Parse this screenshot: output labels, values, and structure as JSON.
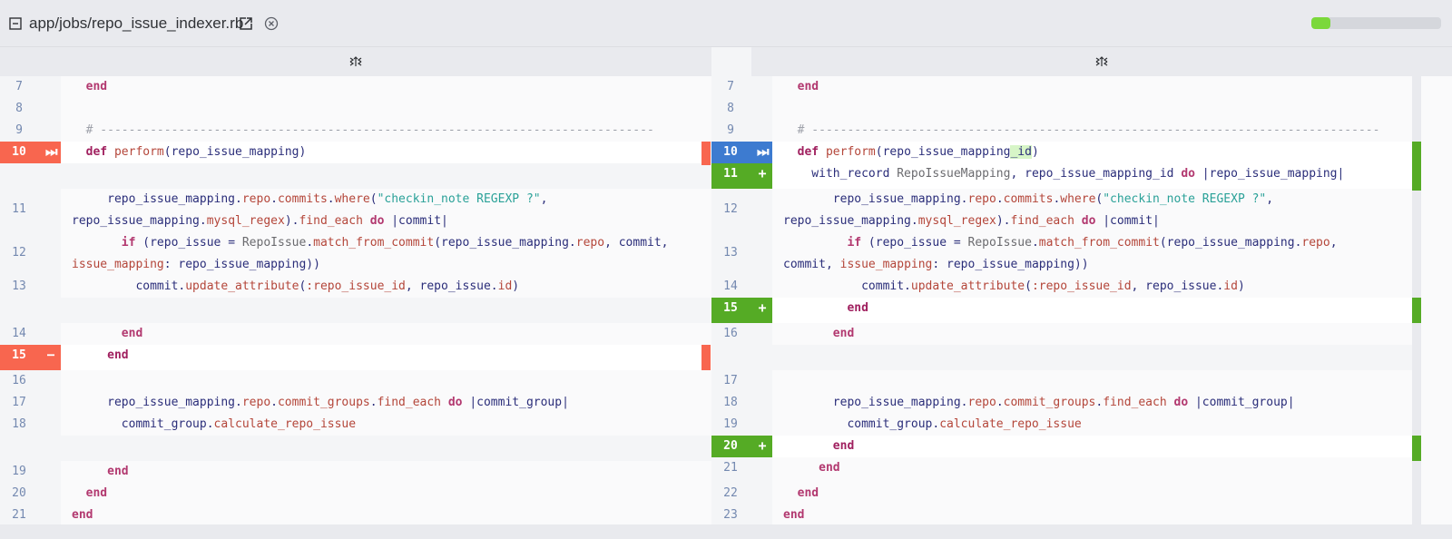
{
  "header": {
    "file_path": "app/jobs/repo_issue_indexer.rb",
    "progress_percent": 15,
    "colors": {
      "progress": "#7bd83b",
      "removed": "#f8664f",
      "changed": "#3d7bd0",
      "added": "#55ab25"
    }
  },
  "icons": {
    "collapse": "collapse-minus-icon",
    "external": "external-link-icon",
    "close": "close-circle-icon",
    "expand": "expand-context-icon"
  },
  "left": {
    "rows": [
      {
        "ln": "7",
        "type": "ctx",
        "tokens": [
          [
            "kw2",
            "  end"
          ]
        ]
      },
      {
        "ln": "8",
        "type": "ctx",
        "tokens": []
      },
      {
        "ln": "9",
        "type": "ctx",
        "tokens": [
          [
            "cmt",
            "  # ------------------------------------------------------------------------------"
          ]
        ]
      },
      {
        "ln": "10",
        "type": "changed-left",
        "marker": "⏭",
        "tokens": [
          [
            "kw",
            "  def "
          ],
          [
            "mth",
            "perform"
          ],
          [
            "punc",
            "(repo_issue_mapping)"
          ]
        ]
      },
      {
        "ln": "",
        "type": "gap",
        "tokens": []
      },
      {
        "ln": "11",
        "type": "ctx2",
        "tokens": [
          [
            "plain",
            "     repo_issue_mapping."
          ],
          [
            "mth",
            "repo"
          ],
          [
            "plain",
            "."
          ],
          [
            "mth",
            "commits"
          ],
          [
            "plain",
            "."
          ],
          [
            "mth",
            "where"
          ],
          [
            "plain",
            "("
          ],
          [
            "str",
            "\"checkin_note REGEXP ?\""
          ],
          [
            "plain",
            ","
          ]
        ],
        "tokens2": [
          [
            "plain",
            "repo_issue_mapping."
          ],
          [
            "mth",
            "mysql_regex"
          ],
          [
            "plain",
            ")."
          ],
          [
            "mth",
            "find_each"
          ],
          [
            "plain",
            " "
          ],
          [
            "kw2",
            "do"
          ],
          [
            "plain",
            " |commit|"
          ]
        ]
      },
      {
        "ln": "12",
        "type": "ctx2",
        "tokens": [
          [
            "plain",
            "       "
          ],
          [
            "kw2",
            "if"
          ],
          [
            "plain",
            " (repo_issue = "
          ],
          [
            "const",
            "RepoIssue"
          ],
          [
            "plain",
            "."
          ],
          [
            "mth",
            "match_from_commit"
          ],
          [
            "plain",
            "(repo_issue_mapping."
          ],
          [
            "mth",
            "repo"
          ],
          [
            "plain",
            ", commit,"
          ]
        ],
        "tokens2": [
          [
            "mth",
            "issue_mapping"
          ],
          [
            "plain",
            ": repo_issue_mapping))"
          ]
        ]
      },
      {
        "ln": "13",
        "type": "ctx",
        "tokens": [
          [
            "plain",
            "         commit."
          ],
          [
            "mth",
            "update_attribute"
          ],
          [
            "plain",
            "("
          ],
          [
            "sym",
            ":repo_issue_id"
          ],
          [
            "plain",
            ", repo_issue."
          ],
          [
            "mth",
            "id"
          ],
          [
            "plain",
            ")"
          ]
        ]
      },
      {
        "ln": "",
        "type": "gap",
        "tokens": []
      },
      {
        "ln": "14",
        "type": "ctx",
        "tokens": [
          [
            "kw2",
            "       end"
          ]
        ]
      },
      {
        "ln": "15",
        "type": "removed",
        "marker": "−",
        "tokens": [
          [
            "kw",
            "     end"
          ]
        ]
      },
      {
        "ln": "16",
        "type": "ctx",
        "tokens": []
      },
      {
        "ln": "17",
        "type": "ctx",
        "tokens": [
          [
            "plain",
            "     repo_issue_mapping."
          ],
          [
            "mth",
            "repo"
          ],
          [
            "plain",
            "."
          ],
          [
            "mth",
            "commit_groups"
          ],
          [
            "plain",
            "."
          ],
          [
            "mth",
            "find_each"
          ],
          [
            "plain",
            " "
          ],
          [
            "kw2",
            "do"
          ],
          [
            "plain",
            " |commit_group|"
          ]
        ]
      },
      {
        "ln": "18",
        "type": "ctx",
        "tokens": [
          [
            "plain",
            "       commit_group."
          ],
          [
            "mth",
            "calculate_repo_issue"
          ]
        ]
      },
      {
        "ln": "",
        "type": "gap",
        "tokens": []
      },
      {
        "ln": "19",
        "type": "ctx",
        "tokens": [
          [
            "kw2",
            "     end"
          ]
        ]
      },
      {
        "ln": "20",
        "type": "ctx",
        "tokens": [
          [
            "kw2",
            "  end"
          ]
        ]
      },
      {
        "ln": "21",
        "type": "ctx",
        "tokens": [
          [
            "kw2",
            "end"
          ]
        ]
      }
    ]
  },
  "right": {
    "rows": [
      {
        "ln": "7",
        "type": "ctx",
        "tokens": [
          [
            "kw2",
            "  end"
          ]
        ]
      },
      {
        "ln": "8",
        "type": "ctx",
        "tokens": []
      },
      {
        "ln": "9",
        "type": "ctx",
        "tokens": [
          [
            "cmt",
            "  # --------------------------------------------------------------------------------"
          ]
        ]
      },
      {
        "ln": "10",
        "type": "changed",
        "marker": "⏭",
        "tokens": [
          [
            "kw",
            "  def "
          ],
          [
            "mth",
            "perform"
          ],
          [
            "punc",
            "(repo_issue_mapping"
          ],
          [
            "hl",
            "_id"
          ],
          [
            "punc",
            ")"
          ]
        ]
      },
      {
        "ln": "11",
        "type": "added",
        "marker": "+",
        "tokens": [
          [
            "plain",
            "    with_record "
          ],
          [
            "const",
            "RepoIssueMapping"
          ],
          [
            "plain",
            ", repo_issue_mapping_id "
          ],
          [
            "kw2",
            "do"
          ],
          [
            "plain",
            " |repo_issue_mapping|"
          ]
        ]
      },
      {
        "ln": "12",
        "type": "ctx2",
        "tokens": [
          [
            "plain",
            "       repo_issue_mapping."
          ],
          [
            "mth",
            "repo"
          ],
          [
            "plain",
            "."
          ],
          [
            "mth",
            "commits"
          ],
          [
            "plain",
            "."
          ],
          [
            "mth",
            "where"
          ],
          [
            "plain",
            "("
          ],
          [
            "str",
            "\"checkin_note REGEXP ?\""
          ],
          [
            "plain",
            ","
          ]
        ],
        "tokens2": [
          [
            "plain",
            "repo_issue_mapping."
          ],
          [
            "mth",
            "mysql_regex"
          ],
          [
            "plain",
            ")."
          ],
          [
            "mth",
            "find_each"
          ],
          [
            "plain",
            " "
          ],
          [
            "kw2",
            "do"
          ],
          [
            "plain",
            " |commit|"
          ]
        ]
      },
      {
        "ln": "13",
        "type": "ctx2",
        "tokens": [
          [
            "plain",
            "         "
          ],
          [
            "kw2",
            "if"
          ],
          [
            "plain",
            " (repo_issue = "
          ],
          [
            "const",
            "RepoIssue"
          ],
          [
            "plain",
            "."
          ],
          [
            "mth",
            "match_from_commit"
          ],
          [
            "plain",
            "(repo_issue_mapping."
          ],
          [
            "mth",
            "repo"
          ],
          [
            "plain",
            ","
          ]
        ],
        "tokens2": [
          [
            "plain",
            "commit, "
          ],
          [
            "mth",
            "issue_mapping"
          ],
          [
            "plain",
            ": repo_issue_mapping))"
          ]
        ]
      },
      {
        "ln": "14",
        "type": "ctx",
        "tokens": [
          [
            "plain",
            "           commit."
          ],
          [
            "mth",
            "update_attribute"
          ],
          [
            "plain",
            "("
          ],
          [
            "sym",
            ":repo_issue_id"
          ],
          [
            "plain",
            ", repo_issue."
          ],
          [
            "mth",
            "id"
          ],
          [
            "plain",
            ")"
          ]
        ]
      },
      {
        "ln": "15",
        "type": "added",
        "marker": "+",
        "tokens": [
          [
            "kw",
            "         end"
          ]
        ]
      },
      {
        "ln": "16",
        "type": "ctx",
        "tokens": [
          [
            "kw2",
            "       end"
          ]
        ]
      },
      {
        "ln": "",
        "type": "gap",
        "tokens": []
      },
      {
        "ln": "17",
        "type": "ctx",
        "tokens": []
      },
      {
        "ln": "18",
        "type": "ctx",
        "tokens": [
          [
            "plain",
            "       repo_issue_mapping."
          ],
          [
            "mth",
            "repo"
          ],
          [
            "plain",
            "."
          ],
          [
            "mth",
            "commit_groups"
          ],
          [
            "plain",
            "."
          ],
          [
            "mth",
            "find_each"
          ],
          [
            "plain",
            " "
          ],
          [
            "kw2",
            "do"
          ],
          [
            "plain",
            " |commit_group|"
          ]
        ]
      },
      {
        "ln": "19",
        "type": "ctx",
        "tokens": [
          [
            "plain",
            "         commit_group."
          ],
          [
            "mth",
            "calculate_repo_issue"
          ]
        ]
      },
      {
        "ln": "20",
        "type": "added",
        "marker": "+",
        "tokens": [
          [
            "kw",
            "       end"
          ]
        ]
      },
      {
        "ln": "21",
        "type": "ctx",
        "tokens": [
          [
            "kw2",
            "     end"
          ]
        ]
      },
      {
        "ln": "22",
        "type": "ctx",
        "tokens": [
          [
            "kw2",
            "  end"
          ]
        ]
      },
      {
        "ln": "23",
        "type": "ctx",
        "tokens": [
          [
            "kw2",
            "end"
          ]
        ]
      }
    ]
  }
}
